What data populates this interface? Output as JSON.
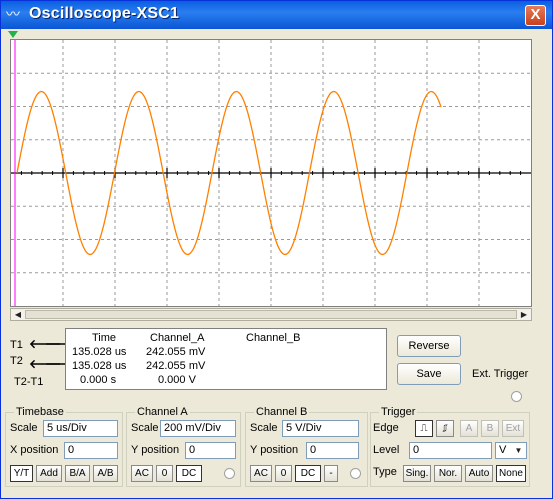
{
  "window": {
    "title": "Oscilloscope-XSC1",
    "close_label": "X",
    "icon": "oscilloscope-icon"
  },
  "colors": {
    "trace": "#ff8000",
    "grid": "#9a9a9a",
    "axis": "#000000",
    "cursor1": "#ff00ff",
    "cursor_marker": "#22b14c"
  },
  "waveform": {
    "cycles": 4.35,
    "amplitude_divs": 2.45
  },
  "cursors": {
    "t1": "T1",
    "t2": "T2",
    "t2t1": "T2-T1"
  },
  "readout": {
    "headers": {
      "time": "Time",
      "a": "Channel_A",
      "b": "Channel_B"
    },
    "rows": [
      {
        "time": "135.028 us",
        "a": "242.055 mV",
        "b": ""
      },
      {
        "time": "135.028 us",
        "a": "242.055 mV",
        "b": ""
      },
      {
        "time": "0.000 s",
        "a": "0.000 V",
        "b": ""
      }
    ]
  },
  "buttons": {
    "reverse": "Reverse",
    "save": "Save",
    "ext_trigger": "Ext. Trigger"
  },
  "timebase": {
    "legend": "Timebase",
    "scale_label": "Scale",
    "scale": "5 us/Div",
    "xpos_label": "X position",
    "xpos": "0",
    "modes": [
      "Y/T",
      "Add",
      "B/A",
      "A/B"
    ]
  },
  "channel_a": {
    "legend": "Channel A",
    "scale_label": "Scale",
    "scale": "200 mV/Div",
    "ypos_label": "Y position",
    "ypos": "0",
    "coupling": [
      "AC",
      "0",
      "DC"
    ]
  },
  "channel_b": {
    "legend": "Channel B",
    "scale_label": "Scale",
    "scale": "5  V/Div",
    "ypos_label": "Y position",
    "ypos": "0",
    "coupling": [
      "AC",
      "0",
      "DC",
      "-"
    ]
  },
  "trigger": {
    "legend": "Trigger",
    "edge_label": "Edge",
    "sources": [
      "A",
      "B",
      "Ext"
    ],
    "level_label": "Level",
    "level": "0",
    "level_unit": "V",
    "type_label": "Type",
    "types": [
      "Sing.",
      "Nor.",
      "Auto",
      "None"
    ]
  }
}
